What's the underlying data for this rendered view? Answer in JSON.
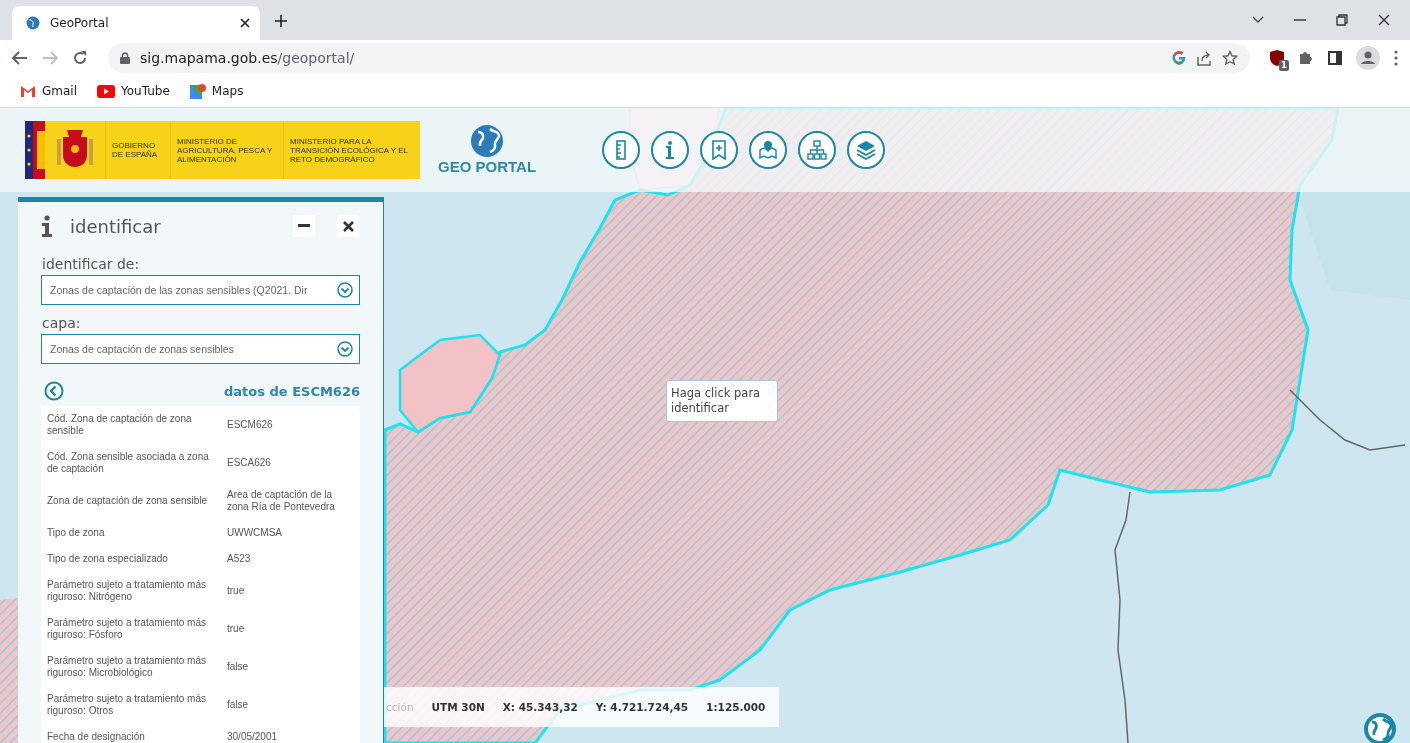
{
  "browser": {
    "tab_title": "GeoPortal",
    "url_host": "sig.mapama.gob.es",
    "url_path": "/geoportal/",
    "extension_badge": "1",
    "bookmarks": [
      "Gmail",
      "YouTube",
      "Maps"
    ]
  },
  "header": {
    "banner": [
      "GOBIERNO DE ESPAÑA",
      "MINISTERIO DE AGRICULTURA, PESCA Y ALIMENTACIÓN",
      "MINISTERIO PARA LA TRANSICIÓN ECOLÓGICA Y EL RETO DEMOGRÁFICO"
    ],
    "logo_text": "GEO PORTAL"
  },
  "panel": {
    "title": "identificar",
    "source_label": "identificar de:",
    "source_value": "Zonas de captación de las zonas sensibles (Q2021. Dir",
    "layer_label": "capa:",
    "layer_value": "Zonas de captación de zonas sensibles",
    "data_title": "datos de ESCM626",
    "rows": [
      {
        "label": "Cód. Zona de captación de zona sensible",
        "value": "ESCM626"
      },
      {
        "label": "Cód. Zona sensible asociada a zona de captación",
        "value": "ESCA626"
      },
      {
        "label": "Zona de captación de zona sensible",
        "value": "Area de captación de la zona Ría de Pontevedra"
      },
      {
        "label": "Tipo de zona",
        "value": "UWWCMSA"
      },
      {
        "label": "Tipo de zona especializado",
        "value": "A523"
      },
      {
        "label": "Parámetro sujeto a tratamiento más riguroso: Nitrógeno",
        "value": "true"
      },
      {
        "label": "Parámetro sujeto a tratamiento más riguroso: Fósforo",
        "value": "true"
      },
      {
        "label": "Parámetro sujeto a tratamiento más riguroso: Microbiológico",
        "value": "false"
      },
      {
        "label": "Parámetro sujeto a tratamiento más riguroso: Otros",
        "value": "false"
      },
      {
        "label": "Fecha de designación",
        "value": "30/05/2001"
      }
    ]
  },
  "tooltip": {
    "text": "Haga click para identificar"
  },
  "status_bar": [
    "cción",
    "UTM 30N",
    "X: 45.343,32",
    "Y: 4.721.724,45",
    "1:125.000"
  ]
}
